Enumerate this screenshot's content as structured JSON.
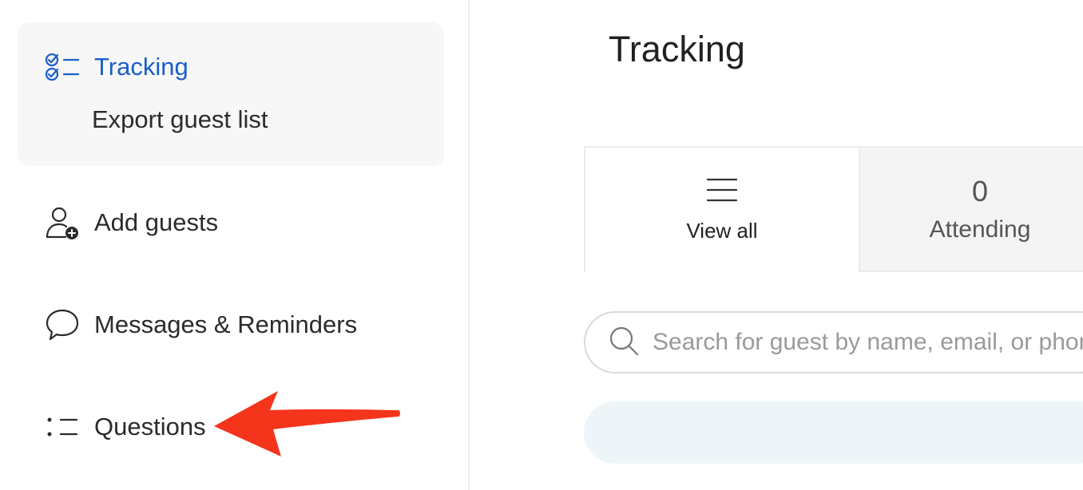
{
  "sidebar": {
    "tracking": {
      "label": "Tracking",
      "icon": "checklist-icon"
    },
    "export_label": "Export guest list",
    "add_guests": {
      "label": "Add guests",
      "icon": "add-person-icon"
    },
    "messages": {
      "label": "Messages & Reminders",
      "icon": "speech-bubble-icon"
    },
    "questions": {
      "label": "Questions",
      "icon": "list-icon"
    }
  },
  "main": {
    "title": "Tracking",
    "tabs": [
      {
        "label": "View all",
        "icon": "menu-lines-icon"
      },
      {
        "count": "0",
        "label": "Attending"
      }
    ],
    "search": {
      "placeholder": "Search for guest by name, email, or phone"
    }
  },
  "colors": {
    "accent": "#1a5fc8",
    "annotation_arrow": "#f5341c",
    "active_card_bg": "#f7f7f7",
    "banner_bg": "#eef5f8"
  }
}
